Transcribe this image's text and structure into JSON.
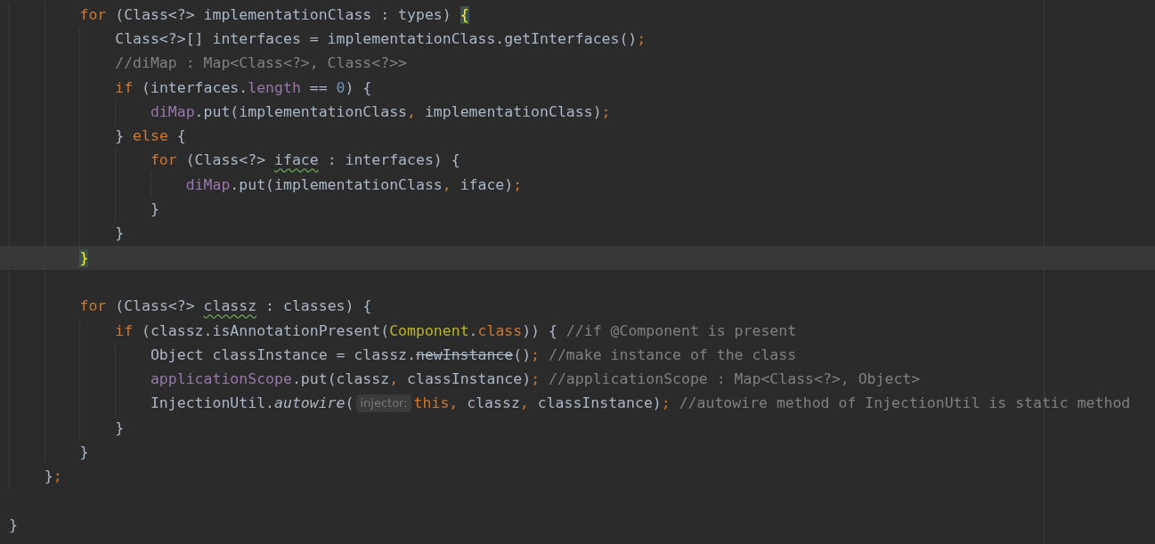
{
  "lines": [
    {
      "kind": "block",
      "children": [
        {
          "kind": "block",
          "children": [
            {
              "kind": "code",
              "current": false,
              "tokens": [
                {
                  "kind": "keyword",
                  "text": "for"
                },
                {
                  "kind": "plain",
                  "text": " (Class<?> implementationClass : types) "
                },
                {
                  "kind": "brace-match",
                  "text": "{"
                }
              ],
              "children": [
                {
                  "kind": "code",
                  "current": false,
                  "tokens": [
                    {
                      "kind": "plain",
                      "text": "Class<?>[] interfaces = implementationClass.getInterfaces()"
                    },
                    {
                      "kind": "punct",
                      "text": ";"
                    }
                  ]
                },
                {
                  "kind": "code",
                  "current": false,
                  "tokens": [
                    {
                      "kind": "comment",
                      "text": "//diMap : Map<Class<?>, Class<?>>"
                    }
                  ]
                },
                {
                  "kind": "code",
                  "current": false,
                  "tokens": [
                    {
                      "kind": "keyword",
                      "text": "if"
                    },
                    {
                      "kind": "plain",
                      "text": " (interfaces."
                    },
                    {
                      "kind": "field",
                      "text": "length"
                    },
                    {
                      "kind": "plain",
                      "text": " == "
                    },
                    {
                      "kind": "number",
                      "text": "0"
                    },
                    {
                      "kind": "plain",
                      "text": ") {"
                    }
                  ],
                  "children": [
                    {
                      "kind": "code",
                      "current": false,
                      "tokens": [
                        {
                          "kind": "field",
                          "text": "diMap"
                        },
                        {
                          "kind": "plain",
                          "text": ".put(implementationClass"
                        },
                        {
                          "kind": "punct",
                          "text": ","
                        },
                        {
                          "kind": "plain",
                          "text": " implementationClass)"
                        },
                        {
                          "kind": "punct",
                          "text": ";"
                        }
                      ]
                    }
                  ]
                },
                {
                  "kind": "code",
                  "current": false,
                  "tokens": [
                    {
                      "kind": "plain",
                      "text": "} "
                    },
                    {
                      "kind": "keyword",
                      "text": "else"
                    },
                    {
                      "kind": "plain",
                      "text": " {"
                    }
                  ],
                  "children": [
                    {
                      "kind": "code",
                      "current": false,
                      "tokens": [
                        {
                          "kind": "keyword",
                          "text": "for"
                        },
                        {
                          "kind": "plain",
                          "text": " (Class<?> "
                        },
                        {
                          "kind": "squiggle",
                          "text": "iface"
                        },
                        {
                          "kind": "plain",
                          "text": " : interfaces) {"
                        }
                      ],
                      "children": [
                        {
                          "kind": "code",
                          "current": false,
                          "tokens": [
                            {
                              "kind": "field",
                              "text": "diMap"
                            },
                            {
                              "kind": "plain",
                              "text": ".put(implementationClass"
                            },
                            {
                              "kind": "punct",
                              "text": ","
                            },
                            {
                              "kind": "plain",
                              "text": " iface)"
                            },
                            {
                              "kind": "punct",
                              "text": ";"
                            }
                          ]
                        }
                      ]
                    },
                    {
                      "kind": "code",
                      "current": false,
                      "tokens": [
                        {
                          "kind": "plain",
                          "text": "}"
                        }
                      ]
                    }
                  ]
                },
                {
                  "kind": "code",
                  "current": false,
                  "tokens": [
                    {
                      "kind": "plain",
                      "text": "}"
                    }
                  ]
                }
              ]
            },
            {
              "kind": "code",
              "current": true,
              "tokens": [
                {
                  "kind": "brace-match",
                  "text": "}"
                }
              ]
            },
            {
              "kind": "blank"
            },
            {
              "kind": "code",
              "current": false,
              "tokens": [
                {
                  "kind": "keyword",
                  "text": "for"
                },
                {
                  "kind": "plain",
                  "text": " (Class<?> "
                },
                {
                  "kind": "squiggle",
                  "text": "classz"
                },
                {
                  "kind": "plain",
                  "text": " : classes) {"
                }
              ],
              "children": [
                {
                  "kind": "code",
                  "current": false,
                  "tokens": [
                    {
                      "kind": "keyword",
                      "text": "if"
                    },
                    {
                      "kind": "plain",
                      "text": " (classz.isAnnotationPresent("
                    },
                    {
                      "kind": "type",
                      "text": "Component"
                    },
                    {
                      "kind": "plain",
                      "text": "."
                    },
                    {
                      "kind": "keyword",
                      "text": "class"
                    },
                    {
                      "kind": "plain",
                      "text": ")) { "
                    },
                    {
                      "kind": "comment",
                      "text": "//if @Component is present"
                    }
                  ],
                  "children": [
                    {
                      "kind": "code",
                      "current": false,
                      "tokens": [
                        {
                          "kind": "plain",
                          "text": "Object classInstance = classz."
                        },
                        {
                          "kind": "deprecated",
                          "text": "newInstance"
                        },
                        {
                          "kind": "plain",
                          "text": "()"
                        },
                        {
                          "kind": "punct",
                          "text": ";"
                        },
                        {
                          "kind": "comment",
                          "text": " //make instance of the class"
                        }
                      ]
                    },
                    {
                      "kind": "code",
                      "current": false,
                      "tokens": [
                        {
                          "kind": "field",
                          "text": "applicationScope"
                        },
                        {
                          "kind": "plain",
                          "text": ".put(classz"
                        },
                        {
                          "kind": "punct",
                          "text": ","
                        },
                        {
                          "kind": "plain",
                          "text": " classInstance)"
                        },
                        {
                          "kind": "punct",
                          "text": ";"
                        },
                        {
                          "kind": "comment",
                          "text": " //applicationScope : Map<Class<?>, Object>"
                        }
                      ]
                    },
                    {
                      "kind": "code",
                      "current": false,
                      "tokens": [
                        {
                          "kind": "plain",
                          "text": "InjectionUtil."
                        },
                        {
                          "kind": "static",
                          "text": "autowire"
                        },
                        {
                          "kind": "plain",
                          "text": "("
                        },
                        {
                          "kind": "hint",
                          "text": "injector:"
                        },
                        {
                          "kind": "keyword",
                          "text": "this"
                        },
                        {
                          "kind": "punct",
                          "text": ","
                        },
                        {
                          "kind": "plain",
                          "text": " classz"
                        },
                        {
                          "kind": "punct",
                          "text": ","
                        },
                        {
                          "kind": "plain",
                          "text": " classInstance)"
                        },
                        {
                          "kind": "punct",
                          "text": ";"
                        },
                        {
                          "kind": "comment",
                          "text": " //autowire method of InjectionUtil is static method"
                        }
                      ]
                    }
                  ]
                },
                {
                  "kind": "code",
                  "current": false,
                  "tokens": [
                    {
                      "kind": "plain",
                      "text": "}"
                    }
                  ]
                }
              ]
            },
            {
              "kind": "code",
              "current": false,
              "tokens": [
                {
                  "kind": "plain",
                  "text": "}"
                }
              ]
            }
          ]
        },
        {
          "kind": "code",
          "current": false,
          "tokens": [
            {
              "kind": "plain",
              "text": "}"
            },
            {
              "kind": "punct",
              "text": ";"
            }
          ]
        }
      ]
    },
    {
      "kind": "blank"
    },
    {
      "kind": "code",
      "current": false,
      "tokens": [
        {
          "kind": "plain",
          "text": "}"
        }
      ]
    }
  ]
}
